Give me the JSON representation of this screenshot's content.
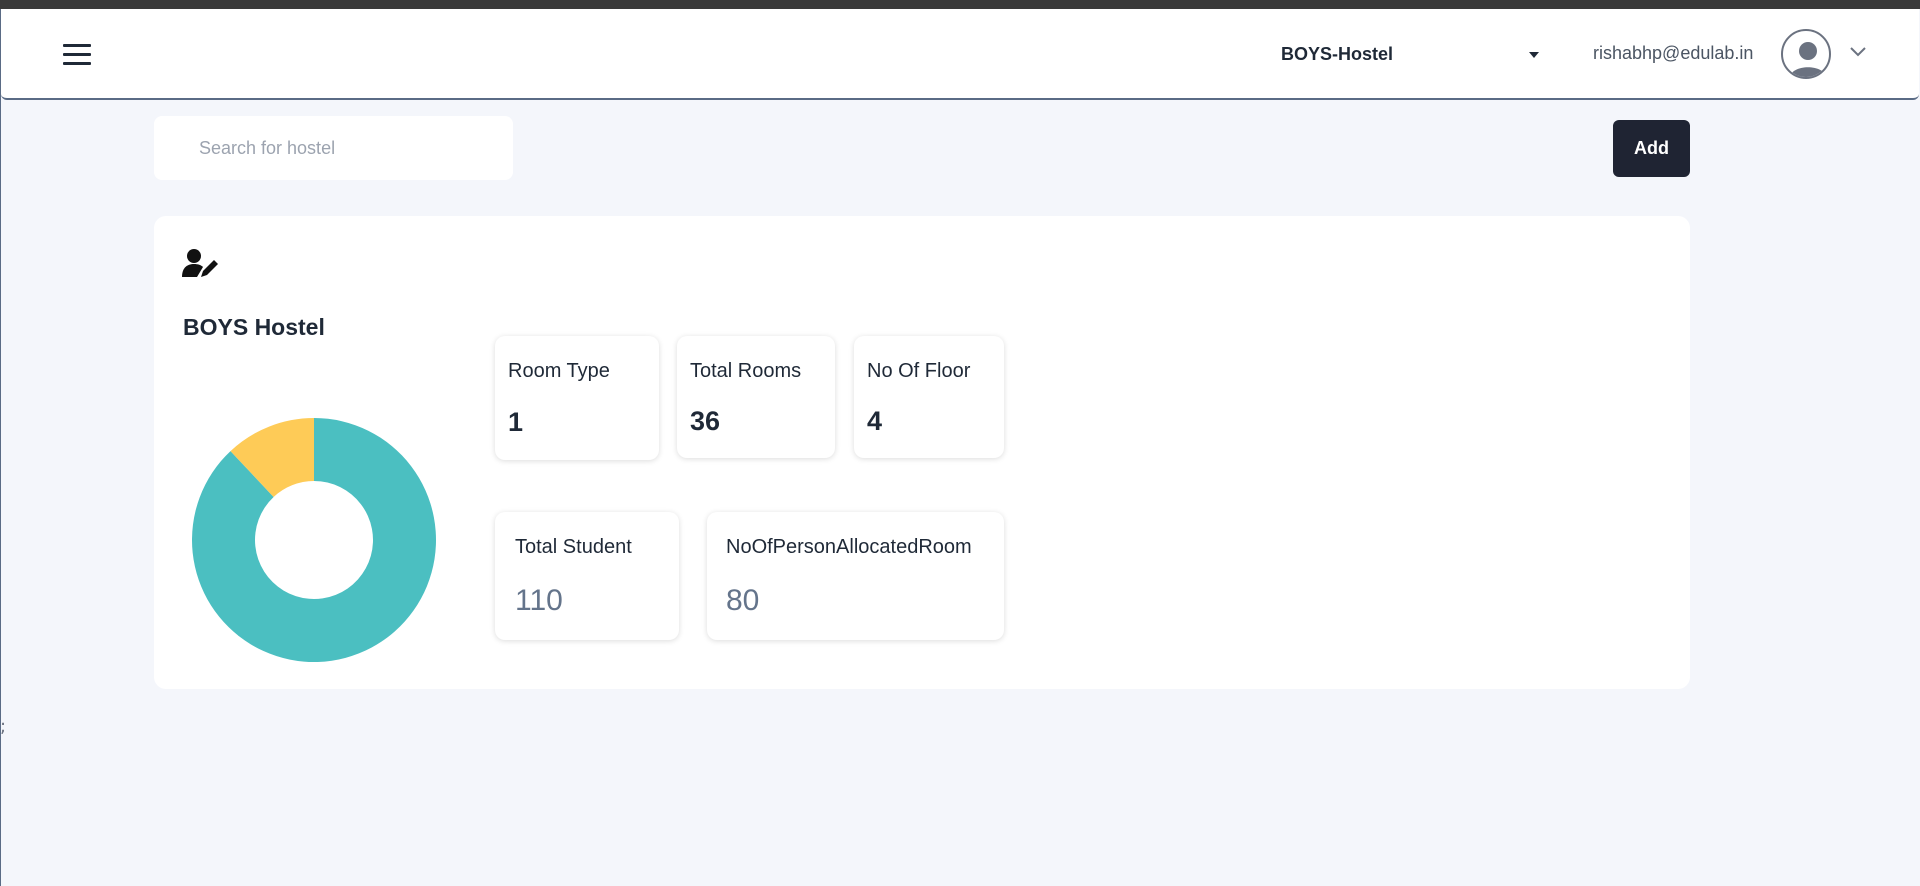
{
  "header": {
    "hostel_select_value": "BOYS-Hostel",
    "user_email": "rishabhp@edulab.in"
  },
  "search": {
    "placeholder": "Search for hostel"
  },
  "toolbar": {
    "add_label": "Add"
  },
  "hostel_card": {
    "title": "BOYS Hostel",
    "stats": [
      {
        "label": "Room Type",
        "value": "1"
      },
      {
        "label": "Total Rooms",
        "value": "36"
      },
      {
        "label": "No Of Floor",
        "value": "4"
      },
      {
        "label": "Total Student",
        "value": "110"
      },
      {
        "label": "NoOfPersonAllocatedRoom",
        "value": "80"
      }
    ],
    "chart_data": {
      "type": "pie",
      "donut": true,
      "slices": [
        {
          "label": "",
          "fraction": 0.88,
          "color": "#4bbfc1"
        },
        {
          "label": "",
          "fraction": 0.12,
          "color": "#fecb57"
        }
      ]
    }
  },
  "colors": {
    "accent": "#1f2433",
    "teal": "#4bbfc1",
    "yellow": "#fecb57",
    "background": "#f4f6fb"
  },
  "icons": [
    "hamburger-menu-icon",
    "caret-down-icon",
    "user-avatar-icon",
    "chevron-down-icon",
    "user-edit-icon"
  ]
}
